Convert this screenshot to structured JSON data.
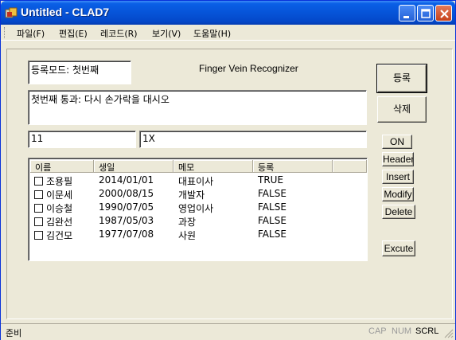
{
  "window": {
    "title": "Untitled - CLAD7"
  },
  "menu": [
    {
      "label": "파일(F)"
    },
    {
      "label": "편집(E)"
    },
    {
      "label": "레코드(R)"
    },
    {
      "label": "보기(V)"
    },
    {
      "label": "도움말(H)"
    }
  ],
  "form": {
    "mode_text": "등록모드: 첫번째",
    "app_label": "Finger Vein Recognizer",
    "message_text": "첫번째 통과: 다시 손가락을 대시오",
    "field1_value": "11",
    "field2_value": "1X"
  },
  "buttons": {
    "register": "등록",
    "delete": "삭제",
    "on": "ON",
    "header": "Header",
    "insert": "Insert",
    "modify": "Modify",
    "delete_en": "Delete",
    "execute": "Excute"
  },
  "table": {
    "columns": [
      "이름",
      "생일",
      "메모",
      "등록"
    ],
    "rows": [
      {
        "name": "조용필",
        "birth": "2014/01/01",
        "memo": "대표이사",
        "reg": "TRUE"
      },
      {
        "name": "이문세",
        "birth": "2000/08/15",
        "memo": "개발자",
        "reg": "FALSE"
      },
      {
        "name": "이승철",
        "birth": "1990/07/05",
        "memo": "영업이사",
        "reg": "FALSE"
      },
      {
        "name": "김완선",
        "birth": "1987/05/03",
        "memo": "과장",
        "reg": "FALSE"
      },
      {
        "name": "김건모",
        "birth": "1977/07/08",
        "memo": "사원",
        "reg": "FALSE"
      }
    ]
  },
  "status": {
    "text": "준비",
    "cap": "CAP",
    "num": "NUM",
    "scrl": "SCRL"
  }
}
